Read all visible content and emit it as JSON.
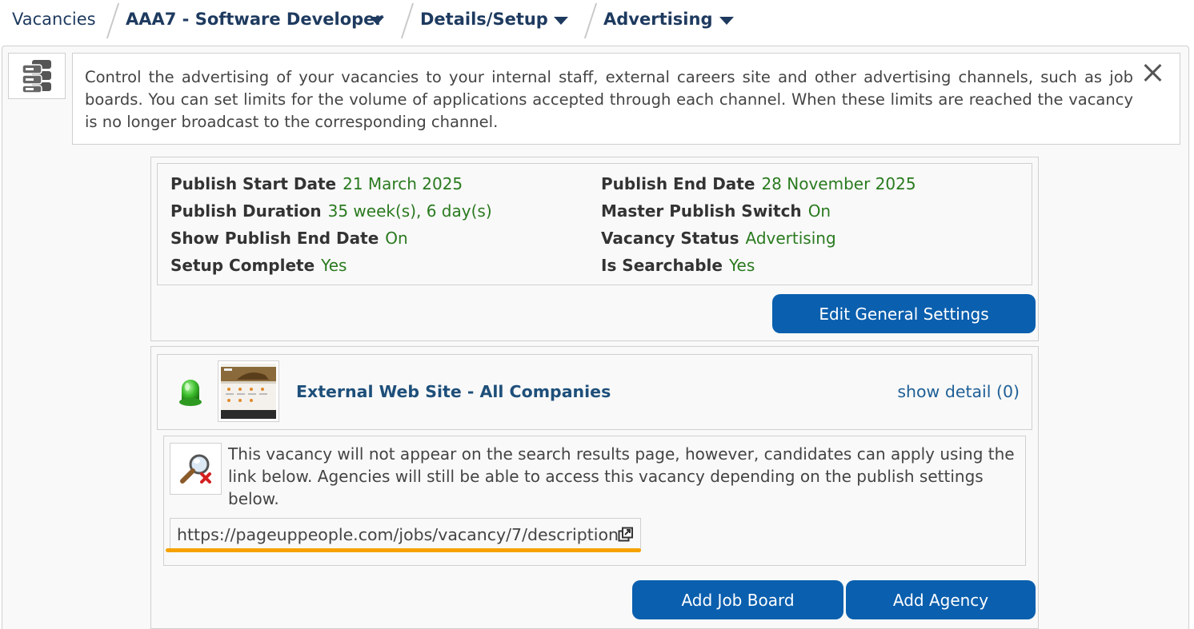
{
  "breadcrumb": {
    "items": [
      {
        "label": "Vacancies"
      },
      {
        "label": "AAA7 - Software Developer"
      },
      {
        "label": "Details/Setup"
      },
      {
        "label": "Advertising"
      }
    ]
  },
  "info": {
    "text": "Control the advertising of your vacancies to your internal staff, external careers site and other advertising channels, such as job boards. You can set limits for the volume of applications accepted through each channel. When these limits are reached the vacancy is no longer broadcast to the corresponding channel."
  },
  "general": {
    "fields": [
      {
        "label": "Publish Start Date",
        "value": "21 March 2025"
      },
      {
        "label": "Publish End Date",
        "value": "28 November 2025"
      },
      {
        "label": "Publish Duration",
        "value": "35 week(s), 6 day(s)"
      },
      {
        "label": "Master Publish Switch",
        "value": "On"
      },
      {
        "label": "Show Publish End Date",
        "value": "On"
      },
      {
        "label": "Vacancy Status",
        "value": "Advertising"
      },
      {
        "label": "Setup Complete",
        "value": "Yes"
      },
      {
        "label": "Is Searchable",
        "value": "Yes"
      }
    ],
    "edit_button": "Edit General Settings"
  },
  "channel": {
    "title": "External Web Site - All Companies",
    "show_detail": "show detail (0)",
    "status_color": "#3fbf2f",
    "notice": "This vacancy will not appear on the search results page, however, candidates can apply using the link below. Agencies will still be able to access this vacancy depending on the publish settings below.",
    "url": "https://pageuppeople.com/jobs/vacancy/7/description"
  },
  "actions": {
    "add_job_board": "Add Job Board",
    "add_agency": "Add Agency"
  },
  "colors": {
    "primary": "#0a5fae",
    "value_green": "#2a7a1f",
    "highlight": "#f5a200"
  }
}
